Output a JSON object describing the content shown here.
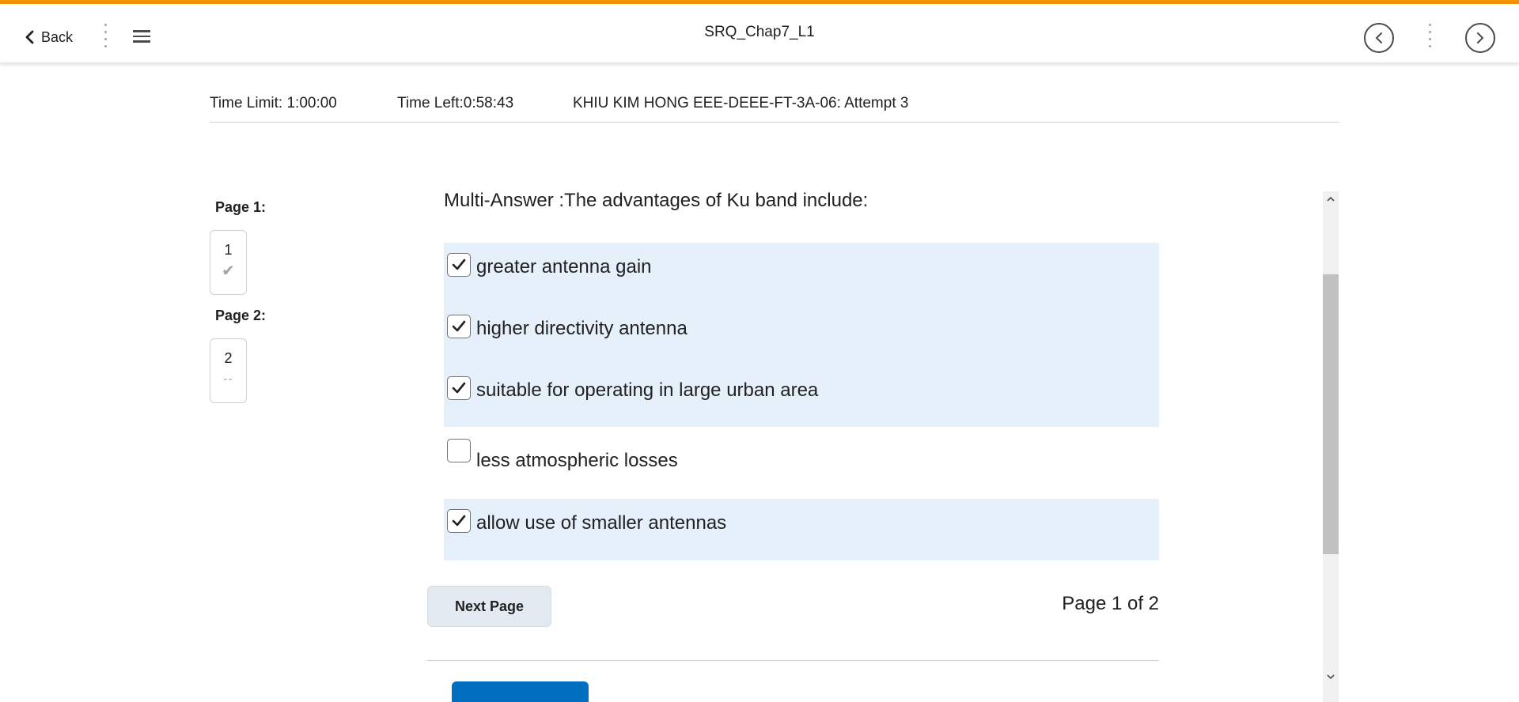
{
  "header": {
    "back_label": "Back",
    "title": "SRQ_Chap7_L1",
    "accent_color": "#f39200"
  },
  "info": {
    "time_limit": "Time Limit: 1:00:00",
    "time_left": "Time Left:0:58:43",
    "attempt": "KHIU KIM HONG EEE-DEEE-FT-3A-06: Attempt 3"
  },
  "sidebar": {
    "pages": [
      {
        "label": "Page 1:",
        "number": "1",
        "status": "answered",
        "mark": "✔"
      },
      {
        "label": "Page 2:",
        "number": "2",
        "status": "unanswered",
        "mark": "--"
      }
    ]
  },
  "question": {
    "text": "Multi-Answer :The advantages of Ku band include:",
    "answers": [
      {
        "label": "greater antenna gain",
        "checked": true
      },
      {
        "label": "higher directivity antenna",
        "checked": true
      },
      {
        "label": "suitable for operating in large urban area",
        "checked": true
      },
      {
        "label": "less atmospheric losses",
        "checked": false
      },
      {
        "label": "allow use of smaller antennas",
        "checked": true
      }
    ],
    "selected_bg_color": "#e6f0fb"
  },
  "footer": {
    "next_label": "Next Page",
    "page_indicator": "Page 1 of 2"
  },
  "icons": {
    "back": "chevron-left-icon",
    "menu": "hamburger-icon",
    "prev": "circle-chevron-left-icon",
    "next": "circle-chevron-right-icon",
    "check": "checkmark-icon"
  }
}
